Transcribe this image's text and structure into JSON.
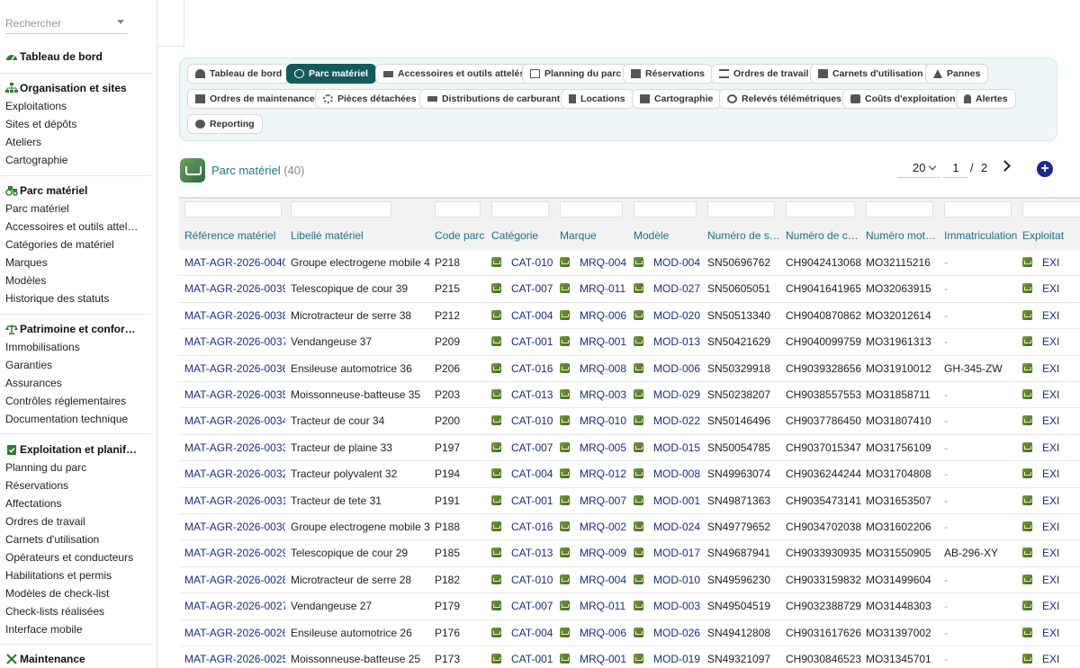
{
  "sidebar": {
    "search_placeholder": "Rechercher",
    "dashboard": "Tableau de bord",
    "sections": [
      {
        "title": "Organisation et sites",
        "items": [
          "Exploitations",
          "Sites et dépôts",
          "Ateliers",
          "Cartographie"
        ]
      },
      {
        "title": "Parc matériel",
        "items": [
          "Parc matériel",
          "Accessoires et outils attel…",
          "Catégories de matériel",
          "Marques",
          "Modèles",
          "Historique des statuts"
        ]
      },
      {
        "title": "Patrimoine et confor…",
        "items": [
          "Immobilisations",
          "Garanties",
          "Assurances",
          "Contrôles réglementaires",
          "Documentation technique"
        ]
      },
      {
        "title": "Exploitation et planif…",
        "items": [
          "Planning du parc",
          "Réservations",
          "Affectations",
          "Ordres de travail",
          "Carnets d'utilisation",
          "Opérateurs et conducteurs",
          "Habilitations et permis",
          "Modèles de check-list",
          "Check-lists réalisées",
          "Interface mobile"
        ]
      },
      {
        "title": "Maintenance",
        "items": []
      }
    ]
  },
  "tabs": [
    "Tableau de bord",
    "Parc matériel",
    "Accessoires et outils attelés",
    "Planning du parc",
    "Réservations",
    "Ordres de travail",
    "Carnets d'utilisation",
    "Pannes",
    "Ordres de maintenance",
    "Pièces détachées",
    "Distributions de carburant",
    "Locations",
    "Cartographie",
    "Relevés télémétriques",
    "Coûts d'exploitation",
    "Alertes",
    "Reporting"
  ],
  "active_tab": "Parc matériel",
  "header": {
    "title": "Parc matériel",
    "count": "(40)",
    "per_page": "20",
    "page": "1",
    "page_sep": "/",
    "page_total": "2"
  },
  "columns": [
    "Référence matériel",
    "Libellé matériel",
    "Code parc",
    "Catégorie",
    "Marque",
    "Modèle",
    "Numéro de s…",
    "Numéro de c…",
    "Numéro mot…",
    "Immatriculation",
    "Exploitat"
  ],
  "rows": [
    [
      "MAT-AGR-2026-0040",
      "Groupe electrogene mobile 40",
      "P218",
      "CAT-010",
      "MRQ-004",
      "MOD-004",
      "SN50696762",
      "CH9042413068",
      "MO32115216",
      "-",
      "EXI"
    ],
    [
      "MAT-AGR-2026-0039",
      "Telescopique de cour 39",
      "P215",
      "CAT-007",
      "MRQ-011",
      "MOD-027",
      "SN50605051",
      "CH9041641965",
      "MO32063915",
      "-",
      "EXI"
    ],
    [
      "MAT-AGR-2026-0038",
      "Microtracteur de serre 38",
      "P212",
      "CAT-004",
      "MRQ-006",
      "MOD-020",
      "SN50513340",
      "CH9040870862",
      "MO32012614",
      "-",
      "EXI"
    ],
    [
      "MAT-AGR-2026-0037",
      "Vendangeuse 37",
      "P209",
      "CAT-001",
      "MRQ-001",
      "MOD-013",
      "SN50421629",
      "CH9040099759",
      "MO31961313",
      "-",
      "EXI"
    ],
    [
      "MAT-AGR-2026-0036",
      "Ensileuse automotrice 36",
      "P206",
      "CAT-016",
      "MRQ-008",
      "MOD-006",
      "SN50329918",
      "CH9039328656",
      "MO31910012",
      "GH-345-ZW",
      "EXI"
    ],
    [
      "MAT-AGR-2026-0035",
      "Moissonneuse-batteuse 35",
      "P203",
      "CAT-013",
      "MRQ-003",
      "MOD-029",
      "SN50238207",
      "CH9038557553",
      "MO31858711",
      "-",
      "EXI"
    ],
    [
      "MAT-AGR-2026-0034",
      "Tracteur de cour 34",
      "P200",
      "CAT-010",
      "MRQ-010",
      "MOD-022",
      "SN50146496",
      "CH9037786450",
      "MO31807410",
      "-",
      "EXI"
    ],
    [
      "MAT-AGR-2026-0033",
      "Tracteur de plaine 33",
      "P197",
      "CAT-007",
      "MRQ-005",
      "MOD-015",
      "SN50054785",
      "CH9037015347",
      "MO31756109",
      "-",
      "EXI"
    ],
    [
      "MAT-AGR-2026-0032",
      "Tracteur polyvalent 32",
      "P194",
      "CAT-004",
      "MRQ-012",
      "MOD-008",
      "SN49963074",
      "CH9036244244",
      "MO31704808",
      "-",
      "EXI"
    ],
    [
      "MAT-AGR-2026-0031",
      "Tracteur de tete 31",
      "P191",
      "CAT-001",
      "MRQ-007",
      "MOD-001",
      "SN49871363",
      "CH9035473141",
      "MO31653507",
      "-",
      "EXI"
    ],
    [
      "MAT-AGR-2026-0030",
      "Groupe electrogene mobile 30",
      "P188",
      "CAT-016",
      "MRQ-002",
      "MOD-024",
      "SN49779652",
      "CH9034702038",
      "MO31602206",
      "-",
      "EXI"
    ],
    [
      "MAT-AGR-2026-0029",
      "Telescopique de cour 29",
      "P185",
      "CAT-013",
      "MRQ-009",
      "MOD-017",
      "SN49687941",
      "CH9033930935",
      "MO31550905",
      "AB-296-XY",
      "EXI"
    ],
    [
      "MAT-AGR-2026-0028",
      "Microtracteur de serre 28",
      "P182",
      "CAT-010",
      "MRQ-004",
      "MOD-010",
      "SN49596230",
      "CH9033159832",
      "MO31499604",
      "-",
      "EXI"
    ],
    [
      "MAT-AGR-2026-0027",
      "Vendangeuse 27",
      "P179",
      "CAT-007",
      "MRQ-011",
      "MOD-003",
      "SN49504519",
      "CH9032388729",
      "MO31448303",
      "-",
      "EXI"
    ],
    [
      "MAT-AGR-2026-0026",
      "Ensileuse automotrice 26",
      "P176",
      "CAT-004",
      "MRQ-006",
      "MOD-026",
      "SN49412808",
      "CH9031617626",
      "MO31397002",
      "-",
      "EXI"
    ],
    [
      "MAT-AGR-2026-0025",
      "Moissonneuse-batteuse 25",
      "P173",
      "CAT-001",
      "MRQ-001",
      "MOD-019",
      "SN49321097",
      "CH9030846523",
      "MO31345701",
      "-",
      "EXI"
    ]
  ]
}
